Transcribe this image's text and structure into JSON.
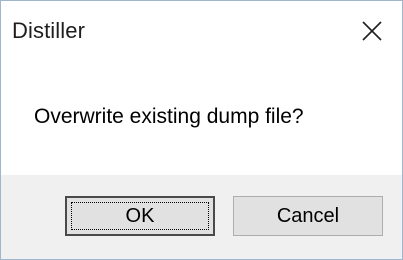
{
  "window": {
    "title": "Distiller",
    "close_icon": "close-icon"
  },
  "dialog": {
    "message": "Overwrite existing dump file?"
  },
  "buttons": {
    "ok_label": "OK",
    "cancel_label": "Cancel"
  },
  "colors": {
    "footer_background": "#f0f0f0",
    "button_background": "#e1e1e1",
    "window_border": "#9fb6cd"
  }
}
